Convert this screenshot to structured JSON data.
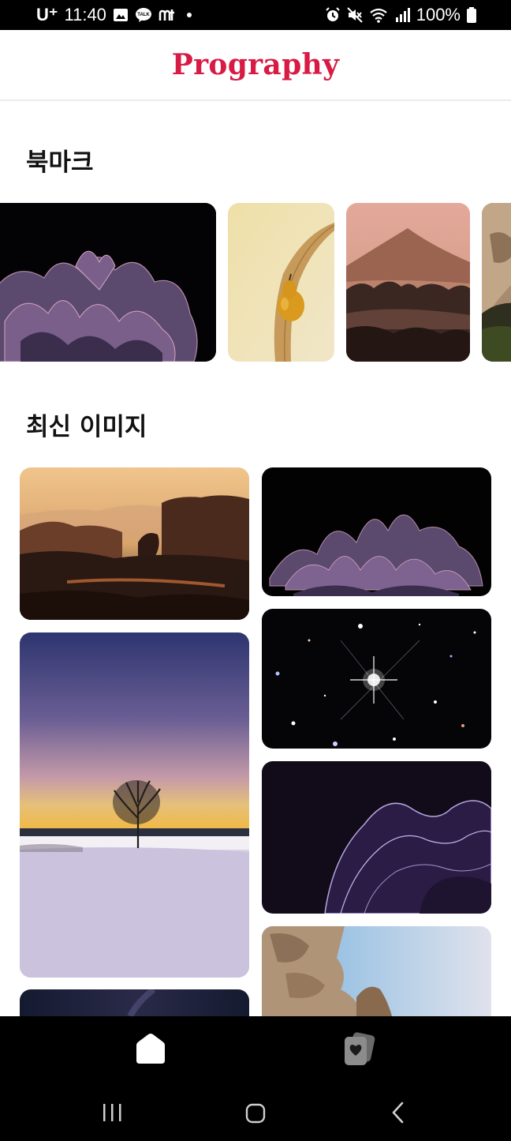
{
  "status_bar": {
    "carrier": "U⁺",
    "time": "11:40",
    "battery": "100%",
    "left_icons": [
      "gallery-icon",
      "kakaotalk-icon",
      "app-icon",
      "dot-icon"
    ],
    "right_icons": [
      "alarm-icon",
      "mute-icon",
      "wifi-icon",
      "signal-icon",
      "battery-icon"
    ]
  },
  "header": {
    "logo": "Prography"
  },
  "bookmarks": {
    "title": "북마크",
    "items": [
      {
        "name": "bookmark-flower"
      },
      {
        "name": "bookmark-pear"
      },
      {
        "name": "bookmark-mountain"
      },
      {
        "name": "bookmark-rock"
      }
    ]
  },
  "latest": {
    "title": "최신 이미지",
    "items": [
      {
        "name": "latest-desert"
      },
      {
        "name": "latest-flower"
      },
      {
        "name": "latest-stars"
      },
      {
        "name": "latest-tree-snow"
      },
      {
        "name": "latest-purple-abstract"
      },
      {
        "name": "latest-canyon"
      },
      {
        "name": "latest-night-sky"
      }
    ]
  },
  "bottom_nav": {
    "items": [
      {
        "icon": "home-icon",
        "active": true
      },
      {
        "icon": "bookmark-heart-icon",
        "active": false
      }
    ]
  },
  "colors": {
    "brand": "#d81b44",
    "nav_background": "#000000"
  }
}
